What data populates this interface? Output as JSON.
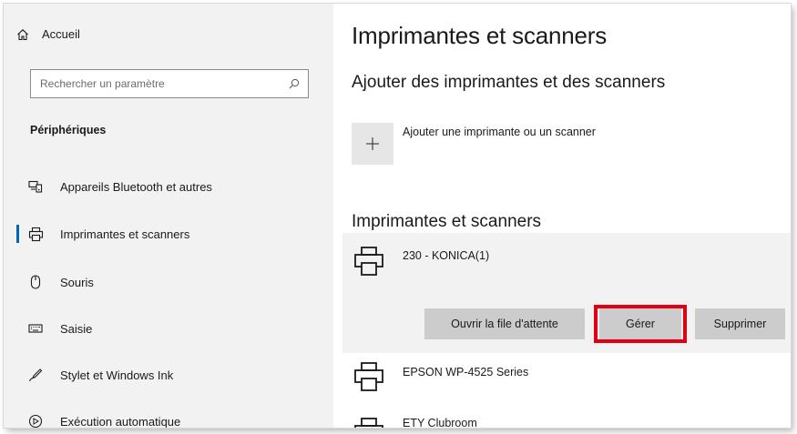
{
  "sidebar": {
    "home_label": "Accueil",
    "search_placeholder": "Rechercher un paramètre",
    "section_heading": "Périphériques",
    "items": [
      {
        "label": "Appareils Bluetooth et autres",
        "icon": "bluetooth-devices-icon"
      },
      {
        "label": "Imprimantes et scanners",
        "icon": "printer-icon",
        "selected": true
      },
      {
        "label": "Souris",
        "icon": "mouse-icon"
      },
      {
        "label": "Saisie",
        "icon": "keyboard-icon"
      },
      {
        "label": "Stylet et Windows Ink",
        "icon": "pen-icon"
      },
      {
        "label": "Exécution automatique",
        "icon": "autoplay-icon"
      }
    ]
  },
  "main": {
    "title": "Imprimantes et scanners",
    "add_section_heading": "Ajouter des imprimantes et des scanners",
    "add_label": "Ajouter une imprimante ou un scanner",
    "printers_heading": "Imprimantes et scanners",
    "printers": [
      {
        "name": "230 - KONICA(1)",
        "selected": true
      },
      {
        "name": "EPSON WP-4525 Series"
      },
      {
        "name": "ETY Clubroom"
      }
    ],
    "actions": {
      "open_queue": "Ouvrir la file d'attente",
      "manage": "Gérer",
      "remove": "Supprimer"
    }
  },
  "colors": {
    "accent": "#0067b8",
    "highlight": "#e00012",
    "sidebar_bg": "#f2f2f2",
    "button_bg": "#cccccc"
  }
}
